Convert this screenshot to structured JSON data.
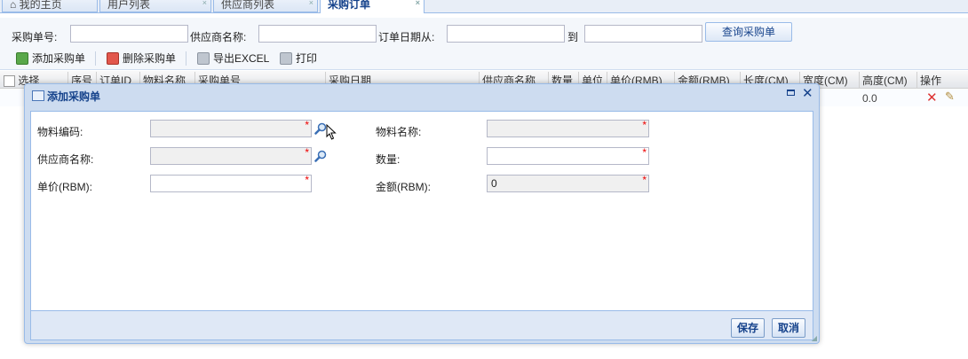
{
  "tabs": [
    {
      "label": "我的主页",
      "icon": "home-icon"
    },
    {
      "label": "用户列表"
    },
    {
      "label": "供应商列表"
    },
    {
      "label": "采购订单"
    }
  ],
  "search": {
    "order_no_label": "采购单号:",
    "supplier_label": "供应商名称:",
    "date_from_label": "订单日期从:",
    "date_to_label": "到",
    "query_button": "查询采购单"
  },
  "toolbar": {
    "add": "添加采购单",
    "delete": "删除采购单",
    "export": "导出EXCEL",
    "print": "打印"
  },
  "grid": {
    "columns": [
      "选择",
      "序号",
      "订单ID",
      "物料名称",
      "采购单号",
      "采购日期",
      "供应商名称",
      "数量",
      "单位",
      "单价(RMB)",
      "金额(RMB)",
      "长度(CM)",
      "宽度(CM)",
      "高度(CM)",
      "操作"
    ],
    "row": {
      "height": "0.0"
    }
  },
  "dialog": {
    "title": "添加采购单",
    "fields": {
      "material_code_label": "物料编码:",
      "material_name_label": "物料名称:",
      "supplier_label": "供应商名称:",
      "quantity_label": "数量:",
      "unit_price_label": "单价(RBM):",
      "amount_label": "金额(RBM):",
      "amount_value": "0",
      "required_mark": "*"
    },
    "save": "保存",
    "cancel": "取消"
  }
}
